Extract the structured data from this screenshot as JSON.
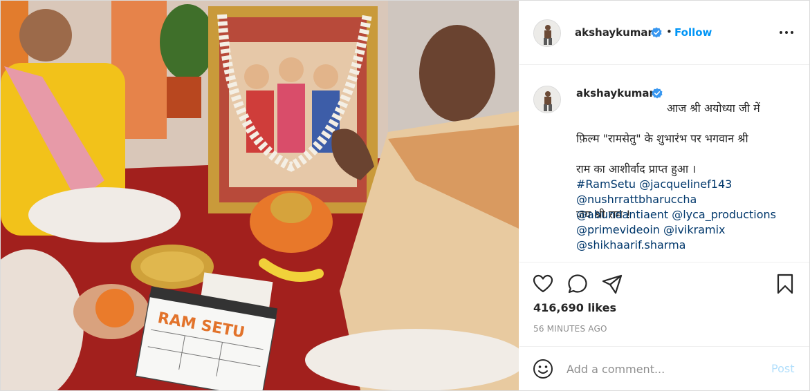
{
  "header": {
    "username": "akshaykumar",
    "separator": "•",
    "follow_label": "Follow",
    "verified_icon": "verified-badge-icon",
    "more_icon": "more-options-icon"
  },
  "caption": {
    "username": "akshaykumar",
    "text": "आज श्री अयोध्या जी में फ़िल्म \"रामसेतु\" के शुभारंभ पर भगवान श्री राम का आशीर्वाद प्राप्त हुआ ।",
    "line1": "आज श्री अयोध्या जी में",
    "line2": "फ़िल्म \"रामसेतु\" के शुभारंभ पर भगवान श्री",
    "line3": "राम का आशीर्वाद प्राप्त हुआ ।",
    "line4": "जय श्री राम !",
    "tags": {
      "hashtag": "#RamSetu",
      "m1": "@jacquelinef143",
      "m2": "@nushrrattbharuccha",
      "m3": "@abundantiaent",
      "m4": "@lyca_productions",
      "m5": "@primevideoin",
      "m6": "@ivikramix",
      "m7": "@shikhaarif.sharma"
    }
  },
  "stats": {
    "likes": "416,690 likes",
    "time": "56 MINUTES AGO"
  },
  "comment": {
    "placeholder": "Add a comment...",
    "post_label": "Post"
  },
  "photo": {
    "clapper_title": "RAM SETU"
  },
  "colors": {
    "link": "#0095f6",
    "mention": "#00376b",
    "post_disabled": "#b2dffc",
    "muted": "#8e8e8e"
  }
}
